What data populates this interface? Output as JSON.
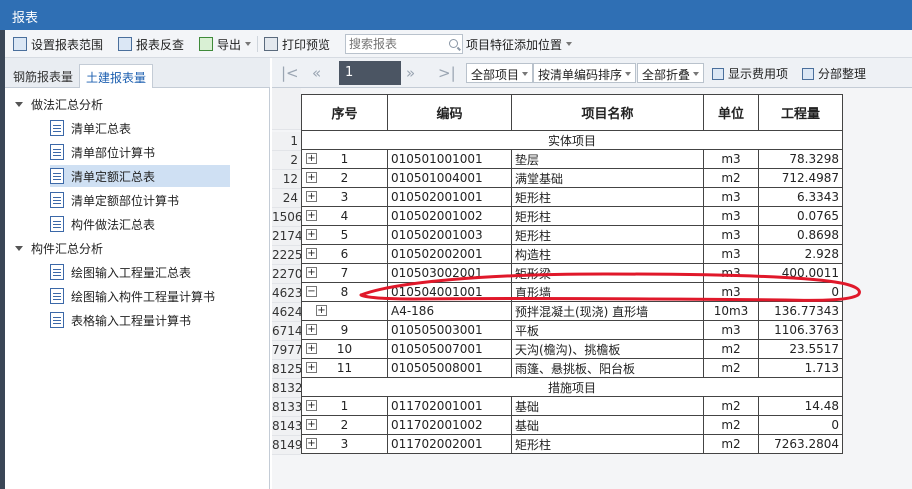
{
  "window": {
    "title": "报表"
  },
  "toolbar": {
    "set_range": "设置报表范围",
    "report_lookup": "报表反查",
    "export": "导出",
    "print_preview": "打印预览",
    "search_placeholder": "搜索报表",
    "feature_position": "项目特征添加位置"
  },
  "left_tabs": [
    "钢筋报表量",
    "土建报表量"
  ],
  "tree": {
    "group1": "做法汇总分析",
    "group1_items": [
      "清单汇总表",
      "清单部位计算书",
      "清单定额汇总表",
      "清单定额部位计算书",
      "构件做法汇总表"
    ],
    "group2": "构件汇总分析",
    "group2_items": [
      "绘图输入工程量汇总表",
      "绘图输入构件工程量计算书",
      "表格输入工程量计算书"
    ],
    "selected": "清单定额汇总表"
  },
  "nav": {
    "page": "1",
    "all_items": "全部项目",
    "sort": "按清单编码排序",
    "fold": "全部折叠",
    "show_cost": "显示费用项",
    "subsection": "分部整理"
  },
  "table": {
    "headers": [
      "序号",
      "编码",
      "项目名称",
      "单位",
      "工程量"
    ],
    "rows": [
      {
        "row": "1",
        "section": "实体项目"
      },
      {
        "row": "2",
        "pm": "+",
        "seq": "1",
        "code": "010501001001",
        "name": "垫层",
        "unit": "m3",
        "qty": "78.3298"
      },
      {
        "row": "12",
        "pm": "+",
        "seq": "2",
        "code": "010501004001",
        "name": "满堂基础",
        "unit": "m2",
        "qty": "712.4987"
      },
      {
        "row": "24",
        "pm": "+",
        "seq": "3",
        "code": "010502001001",
        "name": "矩形柱",
        "unit": "m3",
        "qty": "6.3343"
      },
      {
        "row": "1506",
        "pm": "+",
        "seq": "4",
        "code": "010502001002",
        "name": "矩形柱",
        "unit": "m3",
        "qty": "0.0765"
      },
      {
        "row": "2174",
        "pm": "+",
        "seq": "5",
        "code": "010502001003",
        "name": "矩形柱",
        "unit": "m3",
        "qty": "0.8698"
      },
      {
        "row": "2225",
        "pm": "+",
        "seq": "6",
        "code": "010502002001",
        "name": "构造柱",
        "unit": "m3",
        "qty": "2.928"
      },
      {
        "row": "2270",
        "pm": "+",
        "seq": "7",
        "code": "010503002001",
        "name": "矩形梁",
        "unit": "m3",
        "qty": "400.0011"
      },
      {
        "row": "4623",
        "pm": "−",
        "seq": "8",
        "code": "010504001001",
        "name": "直形墙",
        "unit": "m3",
        "qty": "0"
      },
      {
        "row": "4624",
        "pm": "+",
        "seq": "",
        "code": "A4-186",
        "name": "预拌混凝土(现浇) 直形墙",
        "unit": "10m3",
        "qty": "136.77343",
        "sub": true
      },
      {
        "row": "6714",
        "pm": "+",
        "seq": "9",
        "code": "010505003001",
        "name": "平板",
        "unit": "m3",
        "qty": "1106.3763"
      },
      {
        "row": "7977",
        "pm": "+",
        "seq": "10",
        "code": "010505007001",
        "name": "天沟(檐沟)、挑檐板",
        "unit": "m2",
        "qty": "23.5517"
      },
      {
        "row": "8125",
        "pm": "+",
        "seq": "11",
        "code": "010505008001",
        "name": "雨篷、悬挑板、阳台板",
        "unit": "m2",
        "qty": "1.713"
      },
      {
        "row": "8132",
        "section": "措施项目"
      },
      {
        "row": "8133",
        "pm": "+",
        "seq": "1",
        "code": "011702001001",
        "name": "基础",
        "unit": "m2",
        "qty": "14.48"
      },
      {
        "row": "8143",
        "pm": "+",
        "seq": "2",
        "code": "011702001002",
        "name": "基础",
        "unit": "m2",
        "qty": "0"
      },
      {
        "row": "8149",
        "pm": "+",
        "seq": "3",
        "code": "011702002001",
        "name": "矩形柱",
        "unit": "m2",
        "qty": "7263.2804"
      }
    ]
  },
  "colors": {
    "titlebar": "#2f6fb4",
    "annotation": "#e0182a",
    "selection": "#cfe0f3"
  }
}
